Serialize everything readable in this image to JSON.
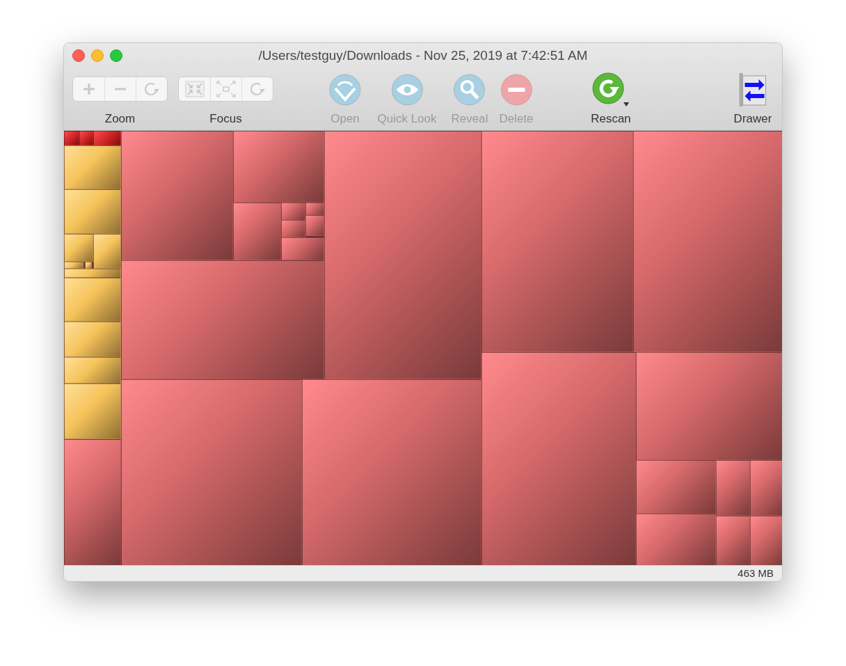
{
  "window": {
    "title": "/Users/testguy/Downloads - Nov 25, 2019 at 7:42:51 AM"
  },
  "toolbar": {
    "segmented_groups": [
      {
        "label": "Zoom",
        "buttons": [
          {
            "kind": "plus",
            "disabled": true
          },
          {
            "kind": "minus",
            "disabled": true
          },
          {
            "kind": "reset",
            "disabled": true
          }
        ]
      },
      {
        "label": "Focus",
        "buttons": [
          {
            "kind": "shrink",
            "disabled": true
          },
          {
            "kind": "expand",
            "disabled": true
          },
          {
            "kind": "reset",
            "disabled": true
          }
        ]
      }
    ],
    "actions": [
      {
        "kind": "open",
        "label": "Open",
        "disabled": true
      },
      {
        "kind": "quicklook",
        "label": "Quick Look",
        "disabled": true
      },
      {
        "kind": "reveal",
        "label": "Reveal",
        "disabled": true
      },
      {
        "kind": "delete",
        "label": "Delete",
        "disabled": true
      },
      {
        "kind": "rescan",
        "label": "Rescan",
        "disabled": false
      },
      {
        "kind": "drawer",
        "label": "Drawer",
        "disabled": false
      }
    ]
  },
  "status_bar": {
    "total_size": "463 MB"
  }
}
